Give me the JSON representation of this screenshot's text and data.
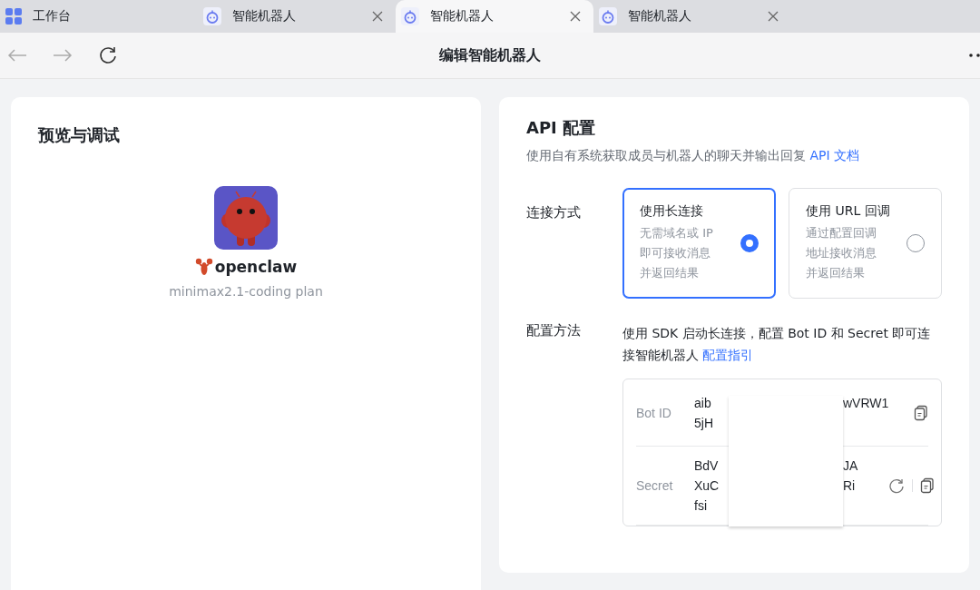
{
  "tabs": [
    {
      "kind": "workspace",
      "label": "工作台",
      "selected": false,
      "closable": false
    },
    {
      "kind": "bot",
      "label": "智能机器人",
      "selected": false,
      "closable": true
    },
    {
      "kind": "bot",
      "label": "智能机器人",
      "selected": true,
      "closable": true
    },
    {
      "kind": "bot",
      "label": "智能机器人",
      "selected": false,
      "closable": true
    }
  ],
  "toolbar": {
    "title": "编辑智能机器人"
  },
  "preview": {
    "title": "预览与调试",
    "bot_name": "openclaw",
    "bot_model": "minimax2.1-coding plan"
  },
  "api_config": {
    "title": "API 配置",
    "description": "使用自有系统获取成员与机器人的聊天并输出回复",
    "doc_link": "API 文档",
    "connection_label": "连接方式",
    "connection_options": [
      {
        "title": "使用长连接",
        "lines": [
          "无需域名或 IP",
          "即可接收消息",
          "并返回结果"
        ],
        "selected": true
      },
      {
        "title": "使用 URL 回调",
        "lines": [
          "通过配置回调",
          "地址接收消息",
          "并返回结果"
        ],
        "selected": false
      }
    ],
    "method_label": "配置方法",
    "method_text": "使用 SDK 启动长连接，配置 Bot ID 和 Secret 即可连接智能机器人",
    "method_link": "配置指引",
    "credentials": [
      {
        "label": "Bot ID",
        "lines": [
          {
            "left": "aib",
            "right": "wVRW1"
          },
          {
            "left": "5jH"
          }
        ],
        "refresh": false
      },
      {
        "label": "Secret",
        "lines": [
          {
            "left": "BdV",
            "right": "JA"
          },
          {
            "left": "XuC",
            "right": "Ri"
          },
          {
            "left": "fsi"
          }
        ],
        "refresh": true
      }
    ]
  }
}
